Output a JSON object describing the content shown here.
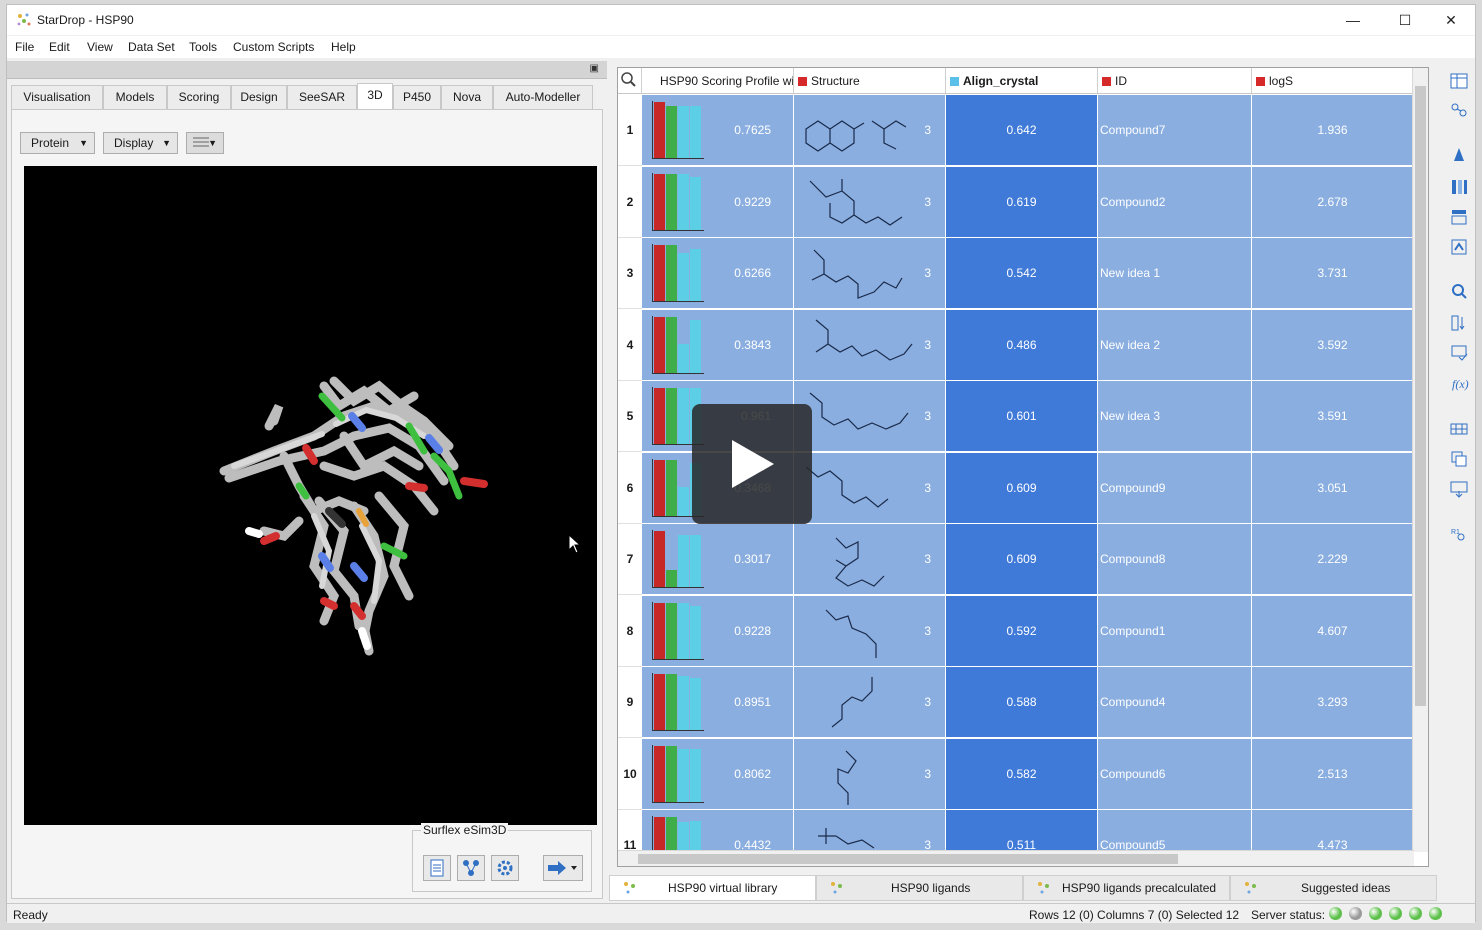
{
  "window": {
    "title": "StarDrop - HSP90",
    "minimize": "—",
    "maximize": "☐",
    "close": "✕"
  },
  "menu": [
    "File",
    "Edit",
    "View",
    "Data Set",
    "Tools",
    "Custom Scripts",
    "Help"
  ],
  "left": {
    "tabs": [
      "Visualisation",
      "Models",
      "Scoring",
      "Design",
      "SeeSAR",
      "3D",
      "P450",
      "Nova",
      "Auto-Modeller"
    ],
    "active_tab": "3D",
    "dropdowns": {
      "protein": "Protein",
      "display": "Display"
    },
    "surflex_label": "Surflex eSim3D"
  },
  "grid": {
    "columns": [
      {
        "label": "HSP90 Scoring Profile wi",
        "color": ""
      },
      {
        "label": "Structure",
        "color": "#d62a2a"
      },
      {
        "label": "Align_crystal",
        "color": "#5bc0e8"
      },
      {
        "label": "ID",
        "color": "#d62a2a"
      },
      {
        "label": "logS",
        "color": "#d62a2a"
      }
    ],
    "rows": [
      {
        "n": "1",
        "score": "0.7625",
        "count": "3",
        "align": "0.642",
        "id": "Compound7",
        "logs": "1.936",
        "b": [
          0.98,
          0.92,
          0.92,
          0.92
        ]
      },
      {
        "n": "2",
        "score": "0.9229",
        "count": "3",
        "align": "0.619",
        "id": "Compound2",
        "logs": "2.678",
        "b": [
          0.98,
          0.98,
          0.98,
          0.92
        ]
      },
      {
        "n": "3",
        "score": "0.6266",
        "count": "3",
        "align": "0.542",
        "id": "New idea 1",
        "logs": "3.731",
        "b": [
          0.98,
          0.98,
          0.85,
          0.92
        ]
      },
      {
        "n": "4",
        "score": "0.3843",
        "count": "3",
        "align": "0.486",
        "id": "New idea 2",
        "logs": "3.592",
        "b": [
          0.98,
          0.98,
          0.5,
          0.92
        ]
      },
      {
        "n": "5",
        "score": "0.961",
        "count": "3",
        "align": "0.601",
        "id": "New idea 3",
        "logs": "3.591",
        "b": [
          0.98,
          0.98,
          0.98,
          0.98
        ]
      },
      {
        "n": "6",
        "score": "0.3468",
        "count": "3",
        "align": "0.609",
        "id": "Compound9",
        "logs": "3.051",
        "b": [
          0.98,
          0.98,
          0.5,
          0.92
        ]
      },
      {
        "n": "7",
        "score": "0.3017",
        "count": "3",
        "align": "0.609",
        "id": "Compound8",
        "logs": "2.229",
        "b": [
          0.98,
          0.3,
          0.92,
          0.92
        ]
      },
      {
        "n": "8",
        "score": "0.9228",
        "count": "3",
        "align": "0.592",
        "id": "Compound1",
        "logs": "4.607",
        "b": [
          0.98,
          0.98,
          0.98,
          0.92
        ]
      },
      {
        "n": "9",
        "score": "0.8951",
        "count": "3",
        "align": "0.588",
        "id": "Compound4",
        "logs": "3.293",
        "b": [
          0.98,
          0.98,
          0.95,
          0.92
        ]
      },
      {
        "n": "10",
        "score": "0.8062",
        "count": "3",
        "align": "0.582",
        "id": "Compound6",
        "logs": "2.513",
        "b": [
          0.98,
          0.98,
          0.92,
          0.92
        ]
      },
      {
        "n": "11",
        "score": "0.4432",
        "count": "3",
        "align": "0.511",
        "id": "Compound5",
        "logs": "4.473",
        "b": [
          0.98,
          0.98,
          0.9,
          0.92
        ]
      }
    ]
  },
  "sheets": [
    "HSP90 virtual library",
    "HSP90 ligands",
    "HSP90 ligands precalculated",
    "Suggested ideas"
  ],
  "status": {
    "left": "Ready",
    "counts": "Rows 12 (0) Columns 7 (0) Selected 12",
    "server_label": "Server status:",
    "server_leds": [
      "#5cc04a",
      "#9a9a9a",
      "#5cc04a",
      "#5cc04a",
      "#5cc04a",
      "#5cc04a"
    ]
  },
  "colors": {
    "bar_red": "#c62828",
    "bar_green": "#3fae49",
    "bar_cyan": "#5ccfe6",
    "cell": "#8aaee0",
    "cell_selected": "#3f7ad8"
  }
}
